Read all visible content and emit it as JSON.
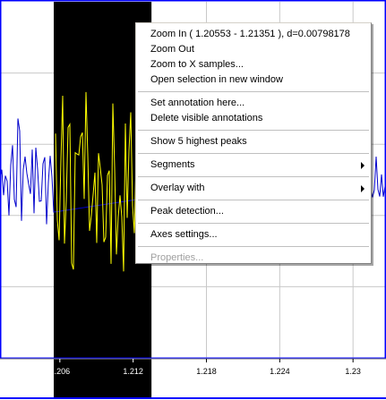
{
  "chart_data": {
    "type": "line",
    "x_tick_labels": [
      "1.206",
      "1.212",
      "1.218",
      "1.224",
      "1.23"
    ],
    "x_ticks": [
      1.206,
      1.212,
      1.218,
      1.224,
      1.23
    ],
    "xlim": [
      1.2011,
      1.2327
    ],
    "ylim": [
      -1.0,
      1.0
    ],
    "selection": [
      1.2055,
      1.2135
    ],
    "grid": true,
    "colors": {
      "signal": "#0000cc",
      "signal_selected": "#ffff00",
      "selection_bg": "#000000",
      "grid": "#c8c8c8",
      "frame": "#0000ff"
    }
  },
  "context_menu": {
    "items": [
      {
        "label": "Zoom In ( 1.20553 - 1.21351 ), d=0.00798178",
        "type": "item",
        "name": "menu-zoom-in"
      },
      {
        "label": "Zoom Out",
        "type": "item",
        "name": "menu-zoom-out"
      },
      {
        "label": "Zoom to X samples...",
        "type": "item",
        "name": "menu-zoom-to-samples"
      },
      {
        "label": "Open selection in new window",
        "type": "item",
        "name": "menu-open-selection"
      },
      {
        "type": "separator"
      },
      {
        "label": "Set annotation here...",
        "type": "item",
        "name": "menu-set-annotation"
      },
      {
        "label": "Delete visible annotations",
        "type": "item",
        "name": "menu-delete-annotations"
      },
      {
        "type": "separator"
      },
      {
        "label": "Show 5 highest peaks",
        "type": "item",
        "name": "menu-show-peaks"
      },
      {
        "type": "separator"
      },
      {
        "label": "Segments",
        "type": "submenu",
        "name": "menu-segments"
      },
      {
        "type": "separator"
      },
      {
        "label": "Overlay with",
        "type": "submenu",
        "name": "menu-overlay-with"
      },
      {
        "type": "separator"
      },
      {
        "label": "Peak detection...",
        "type": "item",
        "name": "menu-peak-detection"
      },
      {
        "type": "separator"
      },
      {
        "label": "Axes settings...",
        "type": "item",
        "name": "menu-axes-settings"
      },
      {
        "type": "separator"
      },
      {
        "label": "Properties...",
        "type": "disabled",
        "name": "menu-properties"
      }
    ]
  }
}
